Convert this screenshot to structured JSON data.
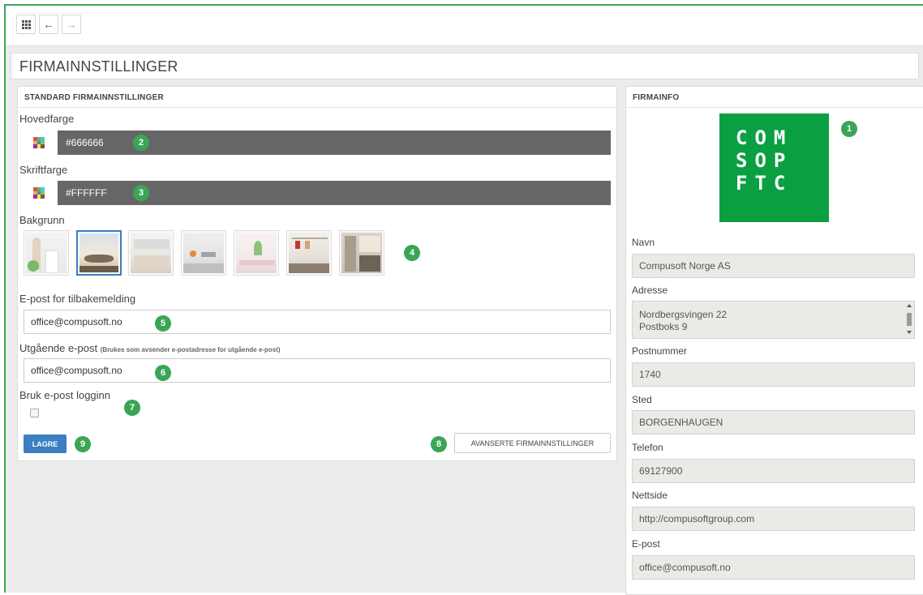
{
  "toolbar": {
    "apps_icon": "grid-icon",
    "back_icon": "←",
    "forward_icon": "→"
  },
  "page_title": "FIRMAINNSTILLINGER",
  "standard": {
    "title": "STANDARD FIRMAINNSTILLINGER",
    "main_color_label": "Hovedfarge",
    "main_color_value": "#666666",
    "font_color_label": "Skriftfarge",
    "font_color_value": "#FFFFFF",
    "background_label": "Bakgrunn",
    "background_selected_index": 1,
    "feedback_email_label": "E-post for tilbakemelding",
    "feedback_email_value": "office@compusoft.no",
    "outgoing_email_label": "Utgående e-post",
    "outgoing_email_hint": "(Brukes som avsender e-postadresse for utgående e-post)",
    "outgoing_email_value": "office@compusoft.no",
    "email_login_label": "Bruk e-post logginn",
    "email_login_checked": false,
    "save_label": "LAGRE",
    "advanced_label": "AVANSERTE FIRMAINNSTILLINGER"
  },
  "firmainfo": {
    "title": "FIRMAINFO",
    "logo_lines": [
      "COM",
      "SOP",
      "FTC"
    ],
    "name_label": "Navn",
    "name_value": "Compusoft Norge AS",
    "address_label": "Adresse",
    "address_line1": "Nordbergsvingen 22",
    "address_line2": "Postboks 9",
    "postnr_label": "Postnummer",
    "postnr_value": "1740",
    "place_label": "Sted",
    "place_value": "BORGENHAUGEN",
    "phone_label": "Telefon",
    "phone_value": "69127900",
    "web_label": "Nettside",
    "web_value": "http://compusoftgroup.com",
    "email_label": "E-post",
    "email_value": "office@compusoft.no"
  },
  "callouts": [
    "1",
    "2",
    "3",
    "4",
    "5",
    "6",
    "7",
    "8",
    "9"
  ],
  "colors": {
    "accent_green": "#3aa655",
    "logo_green": "#0aa042",
    "primary_blue": "#3a7fc1",
    "color_bar": "#666666"
  }
}
